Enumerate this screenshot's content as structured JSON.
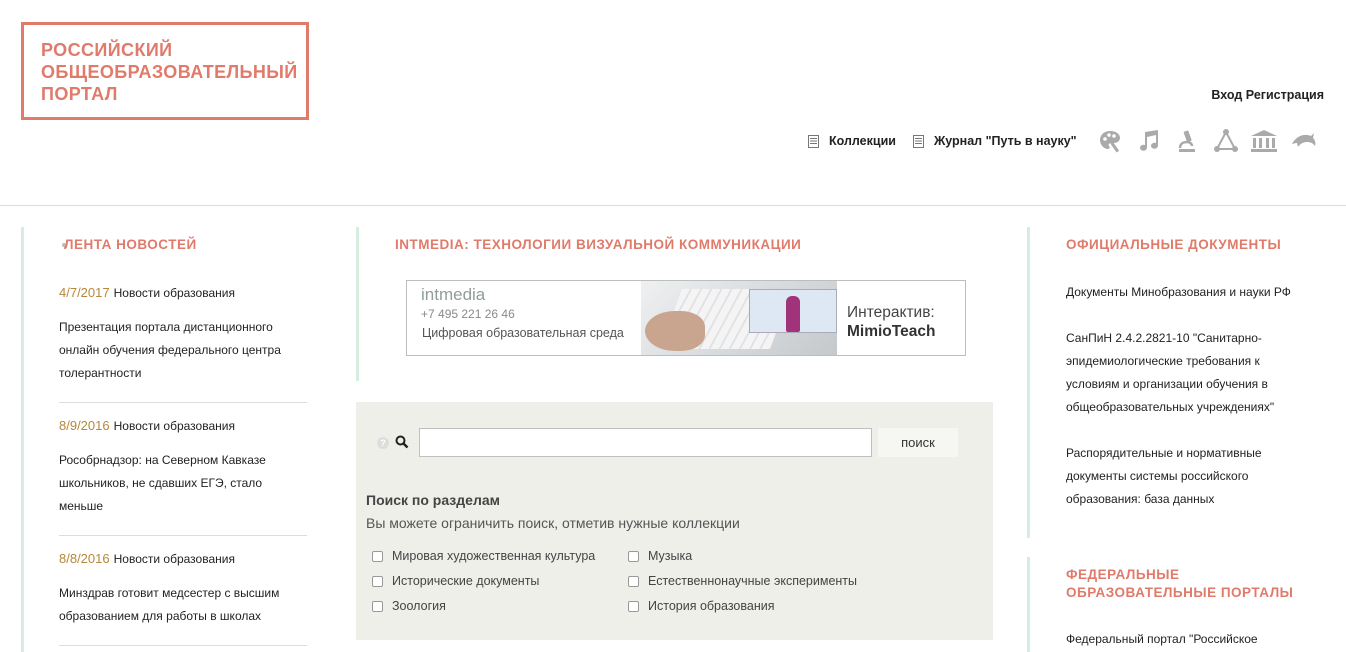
{
  "header": {
    "logo_lines": [
      "РОССИЙСКИЙ",
      "ОБЩЕОБРАЗОВАТЕЛЬНЫЙ",
      "ПОРТАЛ"
    ],
    "login": "Вход",
    "register": "Регистрация",
    "links": [
      "Коллекции",
      "Журнал \"Путь в науку\""
    ],
    "icons": [
      "palette-icon",
      "music-note-icon",
      "microscope-icon",
      "triangle-network-icon",
      "museum-icon",
      "dolphin-icon"
    ]
  },
  "news": {
    "title": "ЛЕНТА НОВОСТЕЙ",
    "items": [
      {
        "date": "4/7/2017",
        "category": "Новости образования",
        "text": "Презентация портала дистанционного онлайн обучения федерального центра толерантности"
      },
      {
        "date": "8/9/2016",
        "category": "Новости образования",
        "text": "Рособрнадзор: на Северном Кавказе школьников, не сдавших ЕГЭ, стало меньше"
      },
      {
        "date": "8/8/2016",
        "category": "Новости образования",
        "text": "Минздрав готовит медсестер с высшим образованием для работы в школах"
      }
    ]
  },
  "middle": {
    "title": "INTMEDIA: ТЕХНОЛОГИИ ВИЗУАЛЬНОЙ КОММУНИКАЦИИ",
    "banner": {
      "logo": "intmedia",
      "phone": "+7 495 221 26 46",
      "tagline": "Цифровая образовательная среда",
      "headline1": "Интерактив:",
      "headline2": "MimioTeach"
    }
  },
  "search": {
    "button": "поиск",
    "input_value": "",
    "sections_title": "Поиск по разделам",
    "sections_sub": "Вы можете ограничить поиск, отметив нужные коллекции",
    "checkboxes": [
      "Мировая художественная культура",
      "Исторические документы",
      "Зоология",
      "Музыка",
      "Естественнонаучные эксперименты",
      "История образования"
    ]
  },
  "right": {
    "docs_title": "ОФИЦИАЛЬНЫЕ ДОКУМЕНТЫ",
    "docs": [
      "Документы Минобразования и науки РФ",
      "СанПиН 2.4.2.2821-10 \"Санитарно-эпидемиологические требования к условиям и организации обучения в общеобразовательных учреждениях\"",
      "Распорядительные и нормативные документы системы российского образования: база данных"
    ],
    "portals_title": "ФЕДЕРАЛЬНЫЕ ОБРАЗОВАТЕЛЬНЫЕ ПОРТАЛЫ",
    "portals_first": "Федеральный портал \"Российское"
  },
  "colors": {
    "accent": "#e07a6a",
    "date": "#b7873b",
    "side_bar": "#d6eedf",
    "search_bg": "#efefe9"
  }
}
